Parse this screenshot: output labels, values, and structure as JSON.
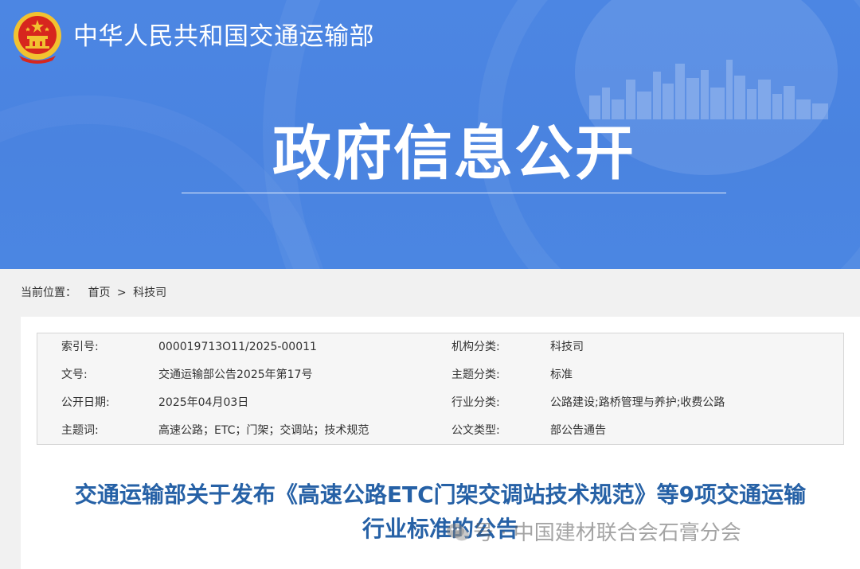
{
  "header": {
    "site_name": "中华人民共和国交通运输部",
    "banner_title": "政府信息公开"
  },
  "breadcrumb": {
    "label": "当前位置：",
    "home": "首页",
    "separator": ">",
    "current": "科技司"
  },
  "meta": {
    "rows": [
      {
        "k1": "索引号:",
        "v1": "000019713O11/2025-00011",
        "k2": "机构分类:",
        "v2": "科技司"
      },
      {
        "k1": "文号:",
        "v1": "交通运输部公告2025年第17号",
        "k2": "主题分类:",
        "v2": "标准"
      },
      {
        "k1": "公开日期:",
        "v1": "2025年04月03日",
        "k2": "行业分类:",
        "v2": "公路建设;路桥管理与养护;收费公路"
      },
      {
        "k1": "主题词:",
        "v1": "高速公路；ETC；门架；交调站；技术规范",
        "k2": "公文类型:",
        "v2": "部公告通告"
      }
    ]
  },
  "document": {
    "title_line1": "交通运输部关于发布《高速公路ETC门架交调站技术规范》等9项交通运输",
    "title_line2": "行业标准的公告"
  },
  "watermark": {
    "text": "号 · 中国建材联合会石膏分会"
  },
  "colors": {
    "banner_blue": "#4a83e0",
    "title_blue": "#2661a6",
    "emblem_red": "#d7261e",
    "emblem_gold": "#f2c230"
  }
}
